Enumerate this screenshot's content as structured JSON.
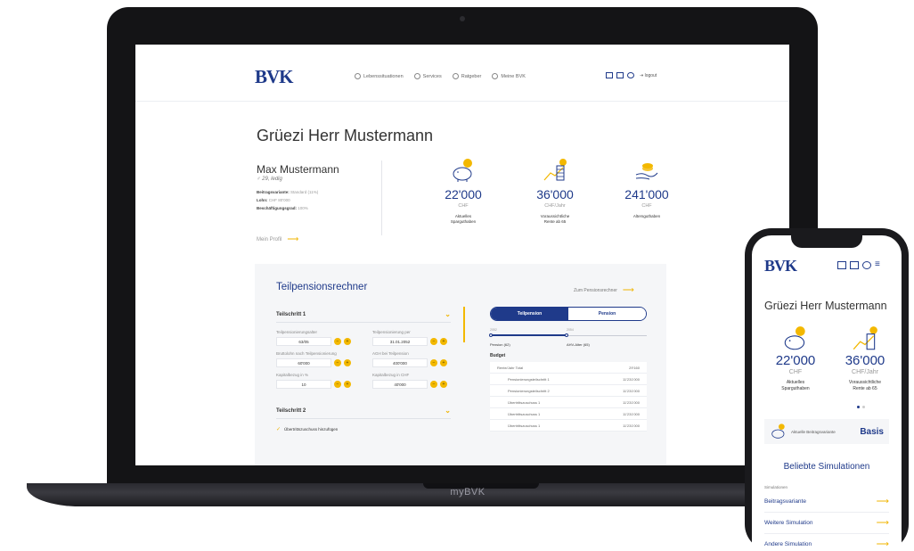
{
  "laptop": {
    "brand": "myBVK",
    "logo": "BVK",
    "nav": [
      {
        "label": "Lebenssituationen",
        "icon": "home-icon"
      },
      {
        "label": "Services",
        "icon": "wifi-icon"
      },
      {
        "label": "Ratgeber",
        "icon": "chat-icon"
      },
      {
        "label": "Meine BVK",
        "icon": "user-icon"
      }
    ],
    "logout": "logout",
    "greeting": "Grüezi Herr Mustermann",
    "profile": {
      "name": "Max Mustermann",
      "info": "♂ 29, ledig",
      "details": [
        {
          "label": "Beitragsvariante:",
          "value": "Standard (11%)"
        },
        {
          "label": "Lohn:",
          "value": "CHF 80'000"
        },
        {
          "label": "Beschäftigungsgrad:",
          "value": "100%"
        }
      ],
      "link": "Mein Profil"
    },
    "stats": [
      {
        "value": "22'000",
        "unit": "CHF",
        "label1": "Aktuelles",
        "label2": "Sparguthaben",
        "icon": "piggy-bank-icon"
      },
      {
        "value": "36'000",
        "unit": "CHF/Jahr",
        "label1": "Voraussichtliche",
        "label2": "Rente ab 65",
        "icon": "chart-coins-icon"
      },
      {
        "value": "241'000",
        "unit": "CHF",
        "label1": "Altersguthaben",
        "label2": "",
        "icon": "hand-coin-icon"
      }
    ],
    "calculator": {
      "title": "Teilpensionsrechner",
      "link": "Zum Pensionsrechner",
      "section1": "Teilschritt 1",
      "fields": [
        {
          "label": "Teilpensionierungsalter",
          "value": "63/05"
        },
        {
          "label": "Teilpensionierung per",
          "value": "31.01.2052"
        },
        {
          "label": "Bruttolohn nach Teilpensionierung",
          "value": "60'000"
        },
        {
          "label": "AGH bei Teilpension",
          "value": "400'000"
        },
        {
          "label": "Kapitalbezug in %",
          "value": "10"
        },
        {
          "label": "Kapitalbezug in CHF",
          "value": "40'000"
        }
      ],
      "section2": "Teilschritt 2",
      "check_label": "Übertrittszuschuss hinzufügen",
      "toggle": {
        "active": "Teilpension",
        "inactive": "Pension"
      },
      "slider": {
        "left_label": "2052",
        "right_label": "2054",
        "min_label": "Pension (62)",
        "max_label": "AHV-Alter (65)",
        "fill": 0.49
      },
      "budget_label": "Budget",
      "budget_rows": [
        {
          "label": "Rente/Jahr Total",
          "value": "29'160",
          "sub": false
        },
        {
          "label": "Pensionierungsteilschritt 1",
          "value": "11'231'000",
          "sub": true
        },
        {
          "label": "Pensionierungsteilschritt 2",
          "value": "11'231'000",
          "sub": true
        },
        {
          "label": "Übertrittszuschuss 1",
          "value": "11'231'000",
          "sub": true
        },
        {
          "label": "Übertrittszuschuss 1",
          "value": "11'231'000",
          "sub": true
        },
        {
          "label": "Übertrittszuschuss 1",
          "value": "11'231'000",
          "sub": true
        }
      ]
    }
  },
  "phone": {
    "logo": "BVK",
    "greeting": "Grüezi Herr Mustermann",
    "stats": [
      {
        "value": "22'000",
        "unit": "CHF",
        "label1": "Aktuelles",
        "label2": "Sparguthaben"
      },
      {
        "value": "36'000",
        "unit": "CHF/Jahr",
        "label1": "Voraussichtliche",
        "label2": "Rente ab 65"
      }
    ],
    "card": {
      "label": "Aktuelle Beitragsvariante",
      "value": "Basis"
    },
    "simulations_heading": "Beliebte Simulationen",
    "simulations_title": "Simulationen",
    "simulations": [
      "Beitragsvariante",
      "Weitere Simulation",
      "Andere Simulation"
    ]
  },
  "colors": {
    "primary": "#1f3a8a",
    "accent": "#f3b800"
  }
}
